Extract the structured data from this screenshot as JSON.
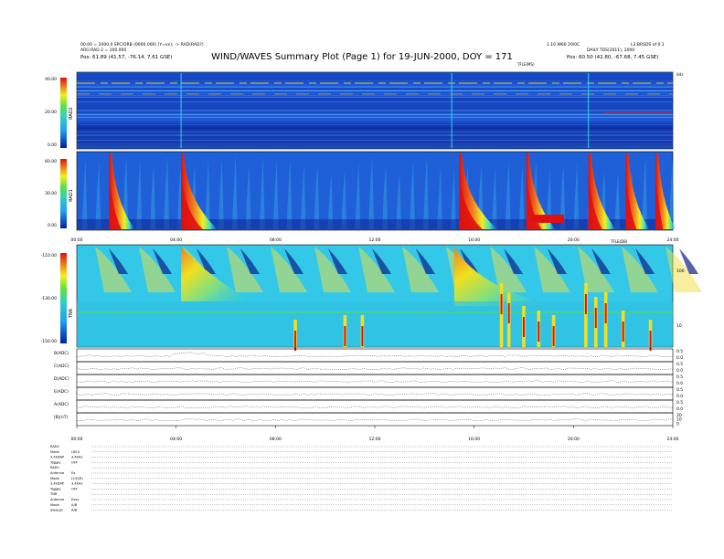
{
  "header": {
    "title": "WIND/WAVES Summary Plot (Page 1) for 19-JUN-2000, DOY = 171",
    "left_line1": "00:00 = 2000.0 SPC/ORB (0000.000) (Y=xx); -> RAD(RAD?)",
    "left_line2": "ARG:RAD 2 = 100.000",
    "left_pos": "Pos:   61.89 (41.57, -76.14, 7.61 GSE)",
    "right_line1": "1.10 W60 20/0C",
    "right_line2": "L3:BRSDS of 0.1",
    "right_line3": "DAILY TDS(2011), 2000",
    "right_pos": "Pos:   60.50 (42.80, -67.68, 7.45 GSE)",
    "rad2_unit": "TFLE(MS)",
    "tnr_unit": "TFLE(DB)",
    "corner_khz": "kHz"
  },
  "colors": {
    "bg_blue": "#1f5fd8",
    "deep_blue": "#0b1f8c",
    "red": "#e01010",
    "yellow": "#f0f020",
    "cyan": "#20d0e0",
    "green": "#30c040"
  },
  "chart_data": [
    {
      "type": "heatmap",
      "name": "RAD2",
      "ylabel": "RAD2",
      "yticks": [
        "40.00",
        "20.00",
        "0.00"
      ],
      "colorbar_ticks": [
        "40.00",
        "20.00",
        "0.00"
      ]
    },
    {
      "type": "heatmap",
      "name": "RAD1",
      "ylabel": "RAD1",
      "yticks": [
        "60.00",
        "30.00",
        "0.00"
      ],
      "colorbar_ticks": [
        "60.00",
        "30.00",
        "0.00"
      ],
      "xticks": [
        "00:00",
        "04:00",
        "08:00",
        "12:00",
        "16:00",
        "20:00",
        "24:00"
      ],
      "bursts_hours": [
        1.3,
        4.2,
        15.4,
        18.1,
        20.6,
        22.1,
        23.3
      ]
    },
    {
      "type": "heatmap",
      "name": "TNR",
      "ylabel": "TNR",
      "yticks": [
        "-110.00",
        "-130.00",
        "-150.00"
      ],
      "right_ticks": [
        "100",
        "10"
      ]
    },
    {
      "type": "line",
      "name": "TDS/Housekeeping strips",
      "series": [
        {
          "name": "B(ADC)",
          "right_ticks": [
            "0.5",
            "0.0"
          ]
        },
        {
          "name": "C(ADC)",
          "right_ticks": [
            "0.5",
            "0.0"
          ]
        },
        {
          "name": "D(ADC)",
          "right_ticks": [
            "0.5",
            "0.0"
          ]
        },
        {
          "name": "E(ADC)",
          "right_ticks": [
            "0.5",
            "0.0"
          ]
        },
        {
          "name": "A(ADC)",
          "right_ticks": [
            "0.5",
            "0.0"
          ]
        },
        {
          "name": "|B|(nT)",
          "right_ticks": [
            "20",
            "10",
            "0"
          ]
        }
      ],
      "xticks": [
        "00:00",
        "04:00",
        "08:00",
        "12:00",
        "16:00",
        "20:00",
        "24:00"
      ]
    }
  ],
  "footer": {
    "rows": [
      {
        "label": "RAD2",
        "value": ""
      },
      {
        "label": "Mode",
        "value": "LIN S"
      },
      {
        "label": "3.4kDAP",
        "value": "3.4kHz"
      },
      {
        "label": "Toggle",
        "value": "OFF"
      },
      {
        "label": "RAD1",
        "value": ""
      },
      {
        "label": "Antenna",
        "value": "Ex"
      },
      {
        "label": "Mode",
        "value": "LOG(R)"
      },
      {
        "label": "3.4kDAP",
        "value": "3.4kHz"
      },
      {
        "label": "Toggle",
        "value": "OFF"
      },
      {
        "label": "TNR",
        "value": ""
      },
      {
        "label": "Antenna",
        "value": "Exsy"
      },
      {
        "label": "Mode",
        "value": "A/B"
      },
      {
        "label": "Sweeps",
        "value": "A/B"
      }
    ]
  }
}
